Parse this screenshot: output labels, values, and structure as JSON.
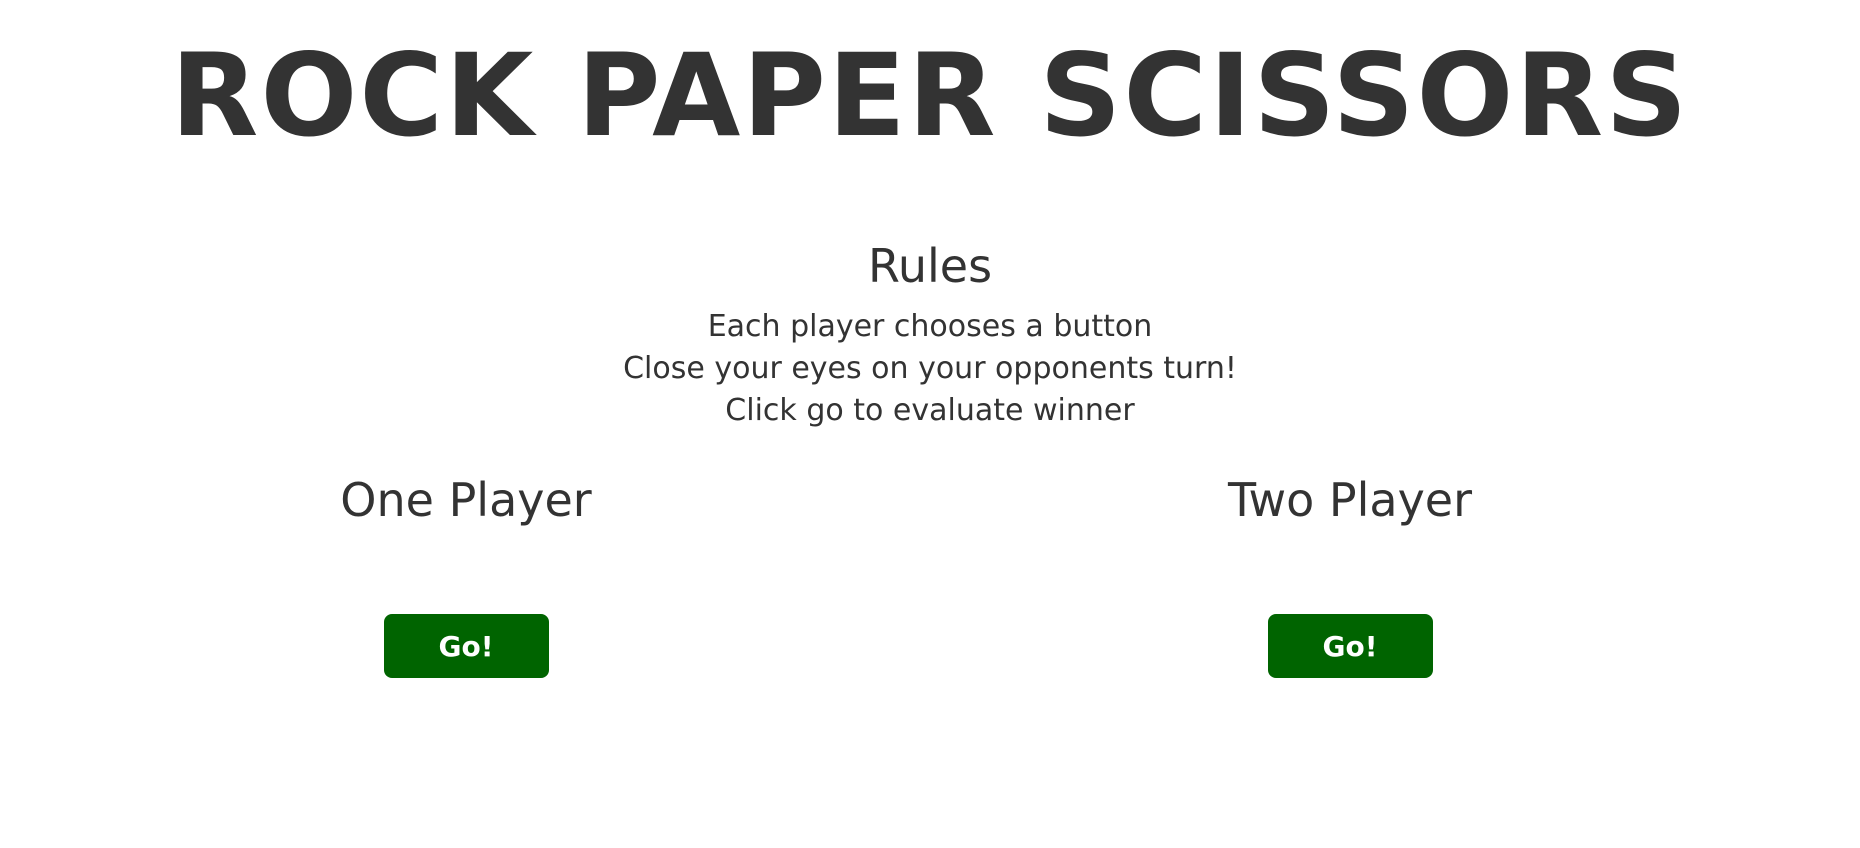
{
  "header": {
    "title": "ROCK PAPER SCISSORS"
  },
  "rules": {
    "heading": "Rules",
    "items": [
      "Each player chooses a button",
      "Close your eyes on your opponents turn!",
      "Click go to evaluate winner"
    ]
  },
  "modes": {
    "one_player": {
      "title": "One Player",
      "button_label": "Go!"
    },
    "two_player": {
      "title": "Two Player",
      "button_label": "Go!"
    }
  },
  "colors": {
    "text": "#333333",
    "button_bg": "#006400",
    "button_text": "#ffffff",
    "background": "#ffffff"
  }
}
